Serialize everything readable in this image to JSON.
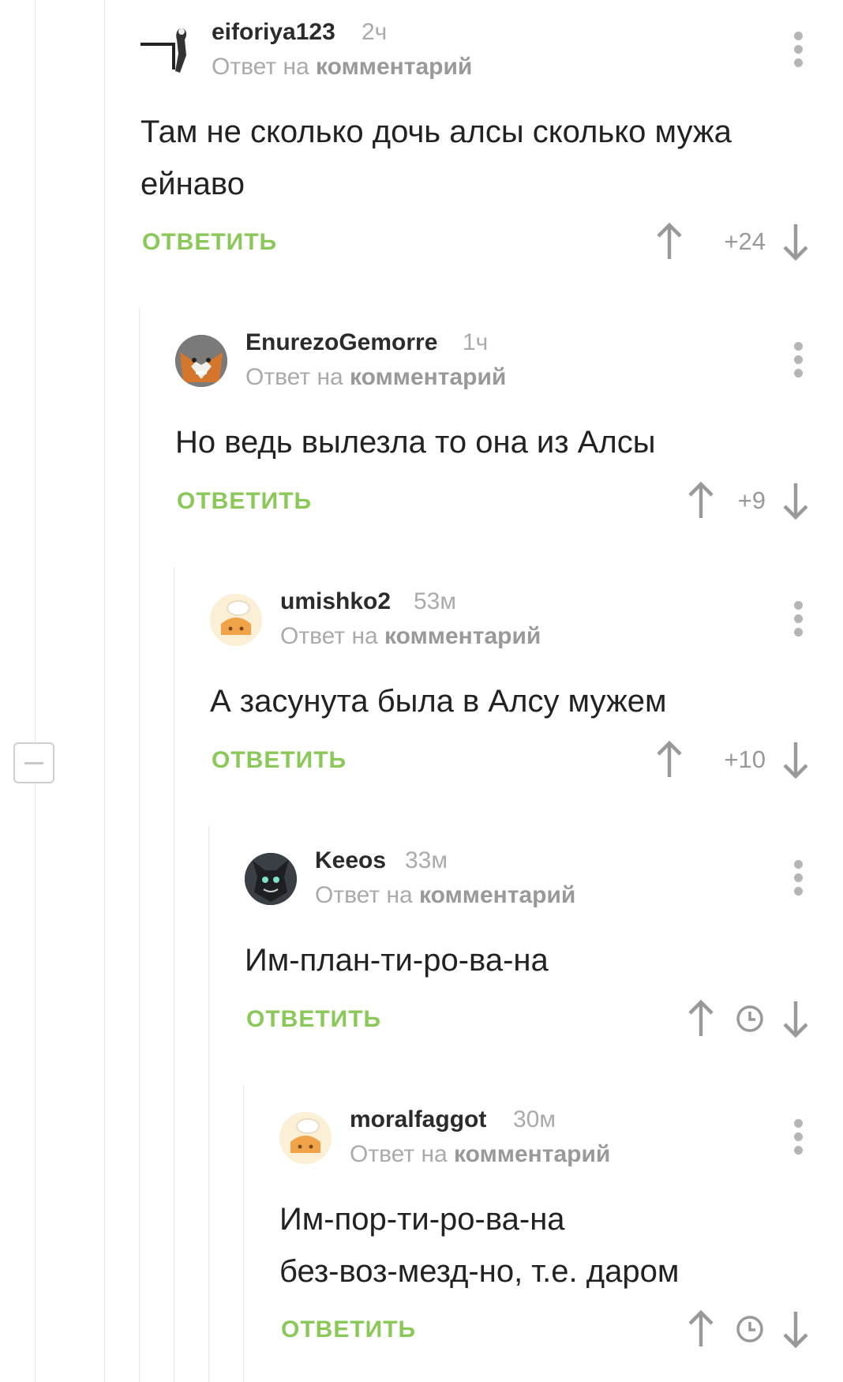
{
  "reply_label": "ОТВЕТИТЬ",
  "reply_to_prefix": "Ответ на",
  "reply_to_link": "комментарий",
  "colors": {
    "reply": "#8ac858",
    "muted": "#aaaaaa",
    "text": "#222222"
  },
  "comments": [
    {
      "username": "eiforiya123",
      "time": "2ч",
      "text_lines": [
        "Там не сколько дочь алсы сколько мужа",
        "ейнаво"
      ],
      "score": "+24",
      "avatar_icon": "figure-avatar-icon"
    },
    {
      "username": "EnurezoGemorre",
      "time": "1ч",
      "text_lines": [
        "Но ведь вылезла то она из Алсы"
      ],
      "score": "+9",
      "avatar_icon": "fox-avatar-icon"
    },
    {
      "username": "umishko2",
      "time": "53м",
      "text_lines": [
        "А засунута была в Алсу мужем"
      ],
      "score": "+10",
      "avatar_icon": "chef-avatar-icon"
    },
    {
      "username": "Keeos",
      "time": "33м",
      "text_lines": [
        "Им-план-ти-ро-ва-на"
      ],
      "score": "",
      "avatar_icon": "dark-creature-avatar-icon"
    },
    {
      "username": "moralfaggot",
      "time": "30м",
      "text_lines": [
        "Им-пор-ти-ро-ва-на",
        "без-воз-мезд-но, т.е. даром"
      ],
      "score": "",
      "avatar_icon": "chef-avatar-icon"
    }
  ]
}
